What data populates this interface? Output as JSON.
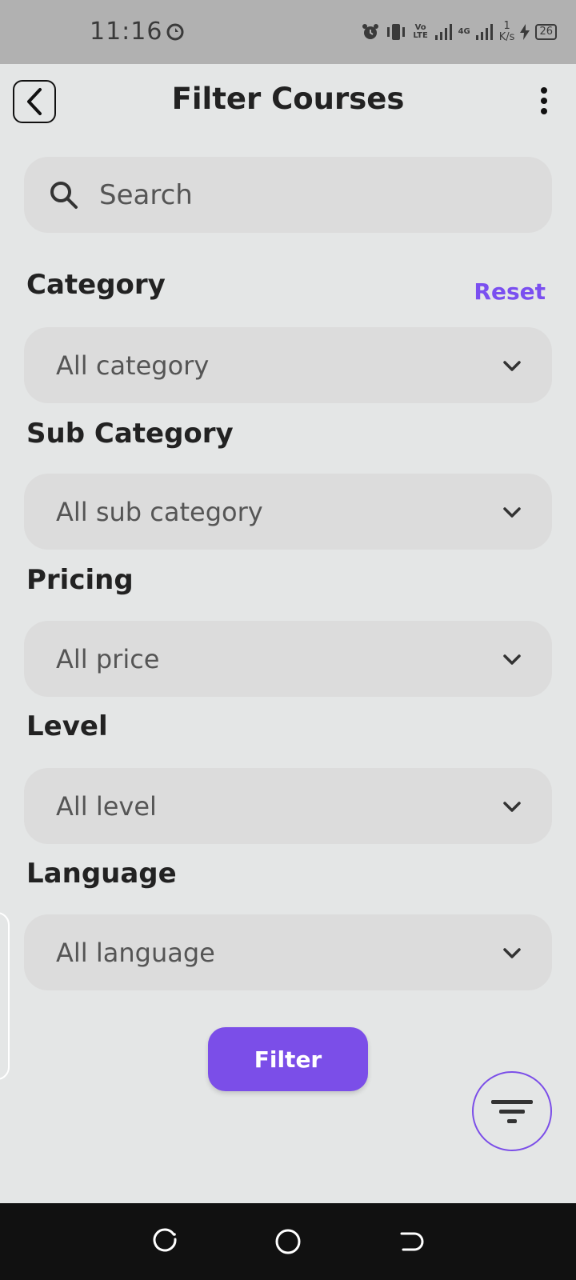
{
  "status_bar": {
    "time": "11:16",
    "network_labels": [
      "Vo LTE",
      "4G"
    ],
    "speed_value": "1",
    "speed_unit": "K/s",
    "battery": "26"
  },
  "header": {
    "title": "Filter Courses"
  },
  "search": {
    "placeholder": "Search"
  },
  "reset_label": "Reset",
  "filters": [
    {
      "label": "Category",
      "value": "All category"
    },
    {
      "label": "Sub Category",
      "value": "All sub category"
    },
    {
      "label": "Pricing",
      "value": "All price"
    },
    {
      "label": "Level",
      "value": "All level"
    },
    {
      "label": "Language",
      "value": "All language"
    }
  ],
  "filter_button": "Filter",
  "colors": {
    "accent": "#7b4ee8",
    "background": "#e4e6e6",
    "field": "#dcdcdc"
  }
}
